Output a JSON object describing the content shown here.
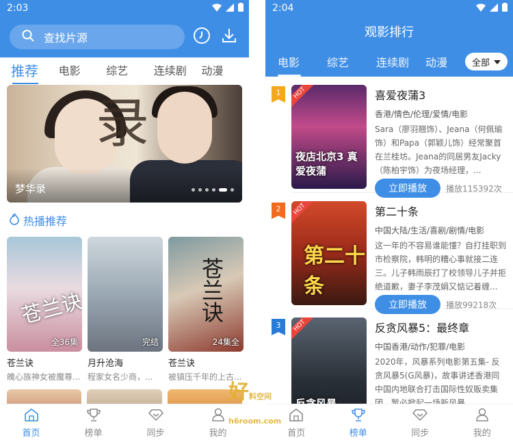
{
  "left": {
    "status_time": "2:03",
    "search_placeholder": "查找片源",
    "tabs": [
      "推荐",
      "电影",
      "综艺",
      "连续剧",
      "动漫"
    ],
    "banner_caption": "梦华录",
    "banner_char": "录",
    "section_title": "热播推荐",
    "cards": [
      {
        "title": "苍兰诀",
        "sub": "魄心族神女被魔尊...",
        "tag": "全36集",
        "calli": "苍兰诀"
      },
      {
        "title": "月升沧海",
        "sub": "程家女名少商，...",
        "tag": "完结",
        "calli": ""
      },
      {
        "title": "苍兰诀",
        "sub": "被镇压千年的上古...",
        "tag": "24集全",
        "calli": "苍兰诀"
      }
    ]
  },
  "right": {
    "status_time": "2:04",
    "header_title": "观影排行",
    "tabs": [
      "电影",
      "综艺",
      "连续剧",
      "动漫"
    ],
    "filter_label": "全部",
    "hot_label": "HOT",
    "play_label": "立即播放",
    "items": [
      {
        "rank": "1",
        "title": "喜爱夜蒲3",
        "genre": "香港/情色/伦理/爱情/电影",
        "desc": "Sara（廖羽翘饰）、Jeana（何佩瑜饰）和Papa（郭颖儿饰）经常聚首在兰桂坊。Jeana的同居男友Jacky（陈柏宇饰）为夜场经理，...",
        "plays": "播放115392次",
        "poster_text": "夜店北京3 真爱夜蒲"
      },
      {
        "rank": "2",
        "title": "第二十条",
        "genre": "中国大陆/生活/喜剧/剧情/电影",
        "desc": "这一年的不容易谁能懂？自打挂职到市检察院，韩明的糟心事就接二连三。儿子韩雨辰打了校领导儿子并拒绝道歉，妻子李茂娟又惦记着缠...",
        "plays": "播放99218次",
        "poster_text": "第二十条"
      },
      {
        "rank": "3",
        "title": "反贪风暴5：最终章",
        "genre": "中国香港/动作/犯罪/电影",
        "desc": "2020年，风暴系列电影第五集- 反贪风暴5(G风暴)，故事讲述香港同中国内地联合打击国际性奴贩卖集团，暂必掀起一场新风暴。",
        "plays": "",
        "poster_text": "反贪风暴"
      }
    ]
  },
  "nav": [
    "首页",
    "榜单",
    "同步",
    "我的"
  ],
  "watermark": {
    "main": "好",
    "sub": "料空间",
    "url": "h6room.com"
  },
  "colors": {
    "accent": "#3f8ee6",
    "rank1": "#f3a81e",
    "rank2": "#f06b1e",
    "rank3": "#2a7ad8",
    "hot": "#e8453c"
  }
}
